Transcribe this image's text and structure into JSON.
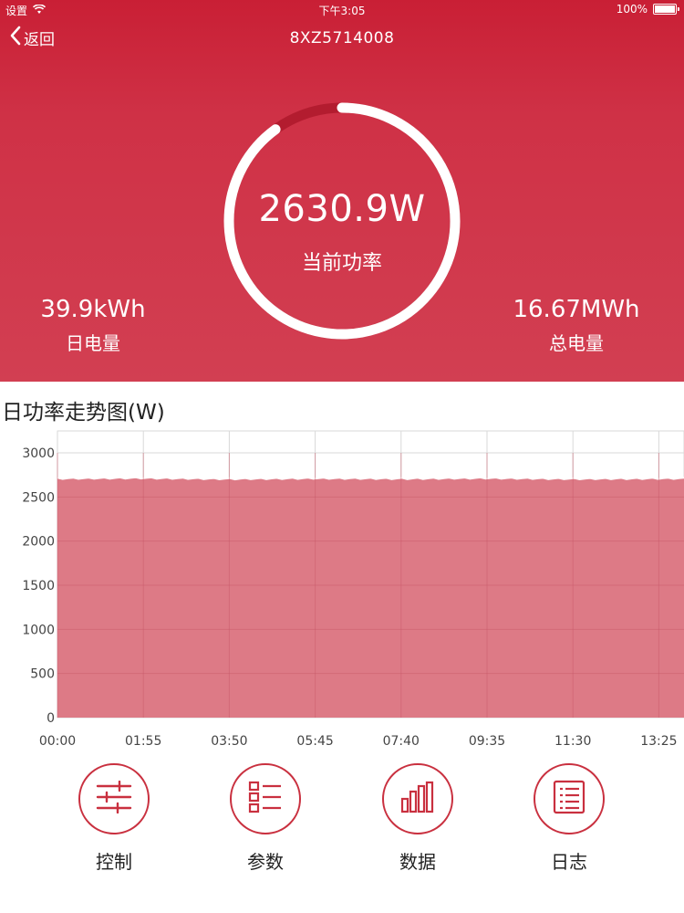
{
  "status_bar": {
    "carrier": "设置",
    "time": "下午3:05",
    "battery": "100%"
  },
  "nav": {
    "back_label": "返回",
    "title": "8XZ5714008"
  },
  "gauge": {
    "value": "2630.9W",
    "label": "当前功率",
    "fill_fraction": 0.9
  },
  "stats": {
    "daily": {
      "value": "39.9kWh",
      "label": "日电量"
    },
    "total": {
      "value": "16.67MWh",
      "label": "总电量"
    }
  },
  "chart_title": "日功率走势图(W)",
  "chart_data": {
    "type": "area",
    "x": [
      "00:00",
      "01:55",
      "03:50",
      "05:45",
      "07:40",
      "09:35",
      "11:30",
      "13:25"
    ],
    "series": [
      {
        "values": [
          2710,
          2715,
          2705,
          2712,
          2708,
          2714,
          2706,
          2710
        ]
      }
    ],
    "ylim": [
      0,
      3000
    ],
    "yticks": [
      0,
      500,
      1000,
      1500,
      2000,
      2500,
      3000
    ],
    "grid": true,
    "colors": {
      "fill": "#dd7a86",
      "line": "#ffffff",
      "grid": "#d9d9d9"
    }
  },
  "actions": [
    {
      "label": "控制",
      "icon": "sliders-icon"
    },
    {
      "label": "参数",
      "icon": "list-icon"
    },
    {
      "label": "数据",
      "icon": "bar-chart-icon"
    },
    {
      "label": "日志",
      "icon": "log-icon"
    }
  ],
  "colors": {
    "brand": "#c9303f",
    "hero_top": "#c91f35",
    "hero_bottom": "#d23f52"
  }
}
